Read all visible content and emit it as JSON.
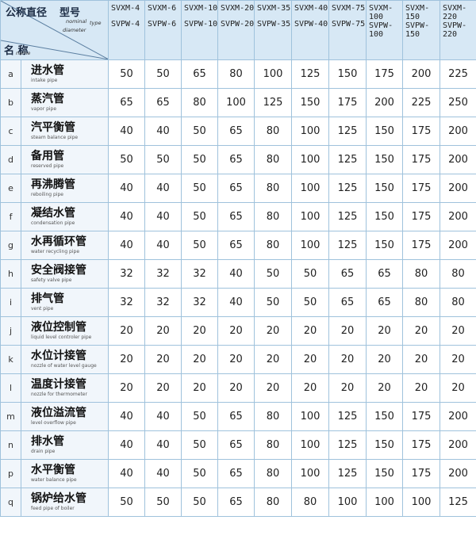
{
  "header": {
    "corner": {
      "nominal_zh": "公称直径",
      "model_zh": "型号",
      "nominal_en_1": "nominal",
      "nominal_en_2": "diameter",
      "type_en": "type",
      "name_zh": "名  称",
      "name_en": "name"
    },
    "models": [
      {
        "top": "SVXM-4",
        "bottom": "SVPW-4"
      },
      {
        "top": "SVXM-6",
        "bottom": "SVPW-6"
      },
      {
        "top": "SVXM-10",
        "bottom": "SVPW-10"
      },
      {
        "top": "SVXM-20",
        "bottom": "SVPW-20"
      },
      {
        "top": "SVXM-35",
        "bottom": "SVPW-35"
      },
      {
        "top": "SVXM-40",
        "bottom": "SVPW-40"
      },
      {
        "top": "SVXM-75",
        "bottom": "SVPW-75"
      },
      {
        "top": "SVXM-\n100\nSVPW-\n100",
        "bottom": ""
      },
      {
        "top": "SVXM-\n150\nSVPW-\n150",
        "bottom": ""
      },
      {
        "top": "SVXM-\n220\nSVPW-\n220",
        "bottom": ""
      }
    ]
  },
  "rows": [
    {
      "letter": "a",
      "zh": "进水管",
      "en": "intake pipe",
      "values": [
        "50",
        "50",
        "65",
        "80",
        "100",
        "125",
        "150",
        "175",
        "200",
        "225"
      ]
    },
    {
      "letter": "b",
      "zh": "蒸汽管",
      "en": "vapor pipe",
      "values": [
        "65",
        "65",
        "80",
        "100",
        "125",
        "150",
        "175",
        "200",
        "225",
        "250"
      ]
    },
    {
      "letter": "c",
      "zh": "汽平衡管",
      "en": "steam balance pipe",
      "values": [
        "40",
        "40",
        "50",
        "65",
        "80",
        "100",
        "125",
        "150",
        "175",
        "200"
      ]
    },
    {
      "letter": "d",
      "zh": "备用管",
      "en": "reserved pipe",
      "values": [
        "50",
        "50",
        "50",
        "65",
        "80",
        "100",
        "125",
        "150",
        "175",
        "200"
      ]
    },
    {
      "letter": "e",
      "zh": "再沸腾管",
      "en": "reboiling pipe",
      "values": [
        "40",
        "40",
        "50",
        "65",
        "80",
        "100",
        "125",
        "150",
        "175",
        "200"
      ]
    },
    {
      "letter": "f",
      "zh": "凝结水管",
      "en": "condensation pipe",
      "values": [
        "40",
        "40",
        "50",
        "65",
        "80",
        "100",
        "125",
        "150",
        "175",
        "200"
      ]
    },
    {
      "letter": "g",
      "zh": "水再循环管",
      "en": "water recycling pipe",
      "values": [
        "40",
        "40",
        "50",
        "65",
        "80",
        "100",
        "125",
        "150",
        "175",
        "200"
      ]
    },
    {
      "letter": "h",
      "zh": "安全阀接管",
      "en": "safety valve pipe",
      "values": [
        "32",
        "32",
        "32",
        "40",
        "50",
        "50",
        "65",
        "65",
        "80",
        "80"
      ]
    },
    {
      "letter": "i",
      "zh": "排气管",
      "en": "vent pipe",
      "values": [
        "32",
        "32",
        "32",
        "40",
        "50",
        "50",
        "65",
        "65",
        "80",
        "80"
      ]
    },
    {
      "letter": "j",
      "zh": "液位控制管",
      "en": "liquid level controler pipe",
      "values": [
        "20",
        "20",
        "20",
        "20",
        "20",
        "20",
        "20",
        "20",
        "20",
        "20"
      ]
    },
    {
      "letter": "k",
      "zh": "水位计接管",
      "en": "nozzle of water level gauge",
      "values": [
        "20",
        "20",
        "20",
        "20",
        "20",
        "20",
        "20",
        "20",
        "20",
        "20"
      ]
    },
    {
      "letter": "l",
      "zh": "温度计接管",
      "en": "nozzle for thermometer",
      "values": [
        "20",
        "20",
        "20",
        "20",
        "20",
        "20",
        "20",
        "20",
        "20",
        "20"
      ]
    },
    {
      "letter": "m",
      "zh": "液位溢流管",
      "en": "level overflow pipe",
      "values": [
        "40",
        "40",
        "50",
        "65",
        "80",
        "100",
        "125",
        "150",
        "175",
        "200"
      ]
    },
    {
      "letter": "n",
      "zh": "排水管",
      "en": "drain pipe",
      "values": [
        "40",
        "40",
        "50",
        "65",
        "80",
        "100",
        "125",
        "150",
        "175",
        "200"
      ]
    },
    {
      "letter": "p",
      "zh": "水平衡管",
      "en": "water balance pipe",
      "values": [
        "40",
        "40",
        "50",
        "65",
        "80",
        "100",
        "125",
        "150",
        "175",
        "200"
      ]
    },
    {
      "letter": "q",
      "zh": "锅炉给水管",
      "en": "feed pipe of boiler",
      "values": [
        "50",
        "50",
        "50",
        "65",
        "80",
        "80",
        "100",
        "100",
        "100",
        "125"
      ]
    }
  ]
}
